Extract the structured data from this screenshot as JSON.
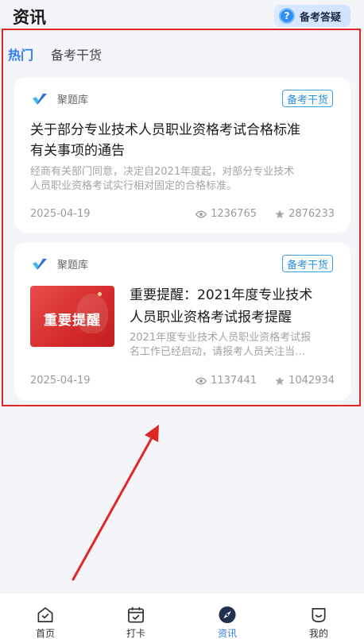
{
  "header": {
    "title": "资讯",
    "qa_button": {
      "label": "备考答疑",
      "icon": "question-icon"
    }
  },
  "tabs": [
    {
      "label": "热门",
      "active": true
    },
    {
      "label": "备考干货",
      "active": false
    }
  ],
  "articles": [
    {
      "source": "聚题库",
      "tag": "备考干货",
      "title_line1": "关于部分专业技术人员职业资格考试合格标准",
      "title_line2": "有关事项的通告",
      "summary_line1": "经商有关部门同意，决定自2021年度起，对部分专业技术",
      "summary_line2": "人员职业资格考试实行相对固定的合格标准。",
      "date": "2025-04-19",
      "views": "1236765",
      "likes": "2876233"
    },
    {
      "source": "聚题库",
      "tag": "备考干货",
      "thumbnail_text": "重要提醒",
      "title_line1": "重要提醒：2021年度专业技术",
      "title_line2": "人员职业资格考试报考提醒",
      "summary_line1": "2021年度专业技术人员职业资格考试报",
      "summary_line2": "名工作已经启动，请报考人员关注当…",
      "date": "2025-04-19",
      "views": "1137441",
      "likes": "1042934"
    }
  ],
  "bottom_nav": [
    {
      "label": "首页",
      "icon": "home-icon",
      "active": false
    },
    {
      "label": "打卡",
      "icon": "calendar-check-icon",
      "active": false
    },
    {
      "label": "资讯",
      "icon": "compass-icon",
      "active": true
    },
    {
      "label": "我的",
      "icon": "profile-icon",
      "active": false
    }
  ],
  "colors": {
    "accent": "#2f7bf5",
    "tag_border": "#3aa0ea",
    "annotation_red": "#e02727",
    "background": "#f4f5f9"
  }
}
